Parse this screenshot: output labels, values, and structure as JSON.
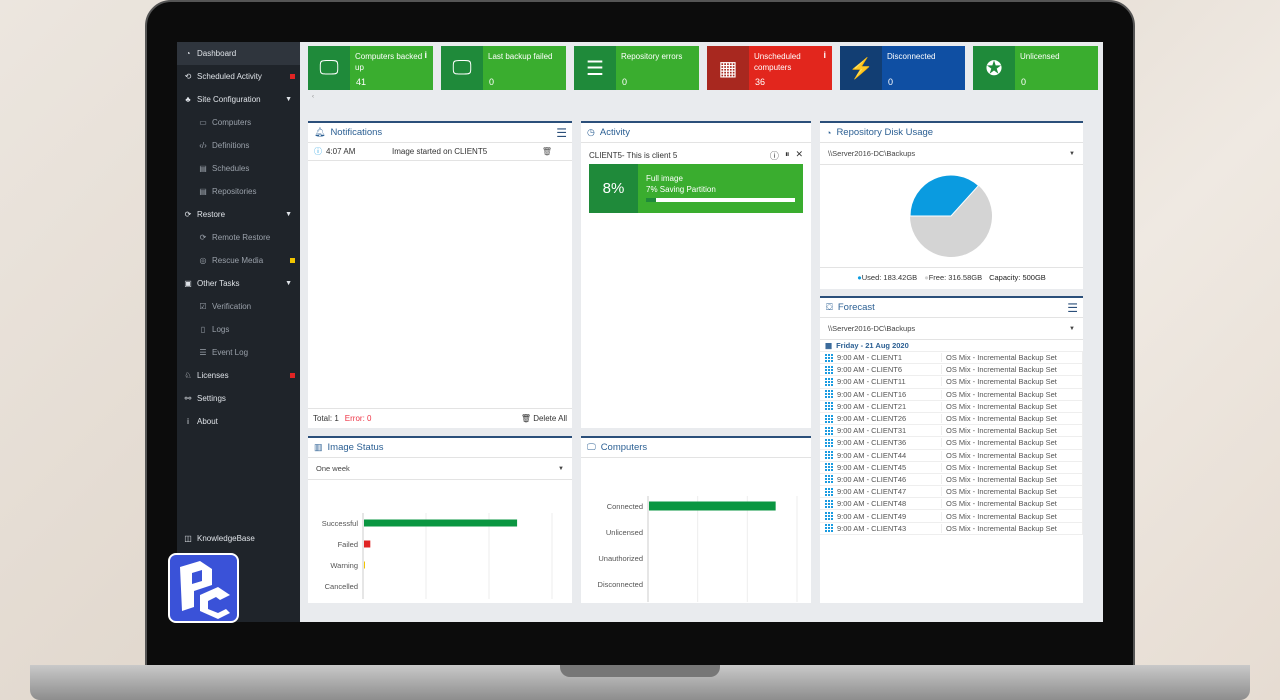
{
  "sidebar": {
    "items": [
      {
        "label": "Dashboard",
        "icon": "◔",
        "name": "dashboard",
        "active": true
      },
      {
        "label": "Scheduled Activity",
        "icon": "⟲",
        "name": "scheduled-activity",
        "flag": "#e02424"
      },
      {
        "label": "Site Configuration",
        "icon": "♣",
        "name": "site-configuration",
        "caret": true
      },
      {
        "label": "Computers",
        "icon": "▭",
        "name": "computers",
        "sub": true
      },
      {
        "label": "Definitions",
        "icon": "‹/›",
        "name": "definitions",
        "sub": true
      },
      {
        "label": "Schedules",
        "icon": "▤",
        "name": "schedules",
        "sub": true
      },
      {
        "label": "Repositories",
        "icon": "▤",
        "name": "repositories",
        "sub": true
      },
      {
        "label": "Restore",
        "icon": "⟳",
        "name": "restore",
        "caret": true
      },
      {
        "label": "Remote Restore",
        "icon": "⟳",
        "name": "remote-restore",
        "sub": true
      },
      {
        "label": "Rescue Media",
        "icon": "◎",
        "name": "rescue-media",
        "sub": true,
        "flag": "#f2c500"
      },
      {
        "label": "Other Tasks",
        "icon": "▣",
        "name": "other-tasks",
        "caret": true
      },
      {
        "label": "Verification",
        "icon": "☑",
        "name": "verification",
        "sub": true
      },
      {
        "label": "Logs",
        "icon": "▯",
        "name": "logs",
        "sub": true
      },
      {
        "label": "Event Log",
        "icon": "☰",
        "name": "event-log",
        "sub": true
      },
      {
        "label": "Licenses",
        "icon": "♘",
        "name": "licenses",
        "flag": "#e02424"
      },
      {
        "label": "Settings",
        "icon": "⚯",
        "name": "settings"
      },
      {
        "label": "About",
        "icon": "i",
        "name": "about"
      }
    ],
    "knowledgebase": "KnowledgeBase"
  },
  "tiles": [
    {
      "label": "Computers backed up",
      "value": "41",
      "icon": "monitor",
      "glyph": "🖵",
      "dark": "#1f8a3a",
      "light": "#3aad2f",
      "info": "i"
    },
    {
      "label": "Last backup failed",
      "value": "0",
      "icon": "monitor",
      "glyph": "🖵",
      "dark": "#1f8a3a",
      "light": "#3aad2f"
    },
    {
      "label": "Repository errors",
      "value": "0",
      "icon": "repository",
      "glyph": "☰",
      "dark": "#1f8a3a",
      "light": "#3aad2f"
    },
    {
      "label": "Unscheduled computers",
      "value": "36",
      "icon": "calendar",
      "glyph": "▦",
      "dark": "#a8281f",
      "light": "#e2261d",
      "info": "i"
    },
    {
      "label": "Disconnected",
      "value": "0",
      "icon": "plug",
      "glyph": "⚡",
      "dark": "#123e73",
      "light": "#0f4fa3"
    },
    {
      "label": "Unlicensed",
      "value": "0",
      "icon": "award",
      "glyph": "✪",
      "dark": "#1f8a3a",
      "light": "#3aad2f"
    }
  ],
  "notifications": {
    "title": "Notifications",
    "items": [
      {
        "time": "4:07 AM",
        "message": "Image started on CLIENT5"
      }
    ],
    "total": "Total: 1",
    "error": "Error: 0",
    "delete_all": "Delete All"
  },
  "activity": {
    "title": "Activity",
    "client": "CLIENT5- This is client 5",
    "percent": "8%",
    "task": "Full image",
    "step": "7% Saving Partition",
    "progress": 0.07
  },
  "disk": {
    "title": "Repository Disk Usage",
    "path": "\\\\Server2016-DC\\Backups",
    "used": "Used: 183.42GB",
    "free": "Free: 316.58GB",
    "capacity": "Capacity: 500GB",
    "used_gb": 183.42,
    "free_gb": 316.58,
    "used_color": "#0a9be0",
    "free_color": "#d4d4d4"
  },
  "forecast": {
    "title": "Forecast",
    "path": "\\\\Server2016-DC\\Backups",
    "date": "Friday - 21 Aug 2020",
    "rows": [
      {
        "time": "9:00 AM - CLIENT1",
        "set": "OS Mix - Incremental Backup Set"
      },
      {
        "time": "9:00 AM - CLIENT6",
        "set": "OS Mix - Incremental Backup Set"
      },
      {
        "time": "9:00 AM - CLIENT11",
        "set": "OS Mix - Incremental Backup Set"
      },
      {
        "time": "9:00 AM - CLIENT16",
        "set": "OS Mix - Incremental Backup Set"
      },
      {
        "time": "9:00 AM - CLIENT21",
        "set": "OS Mix - Incremental Backup Set"
      },
      {
        "time": "9:00 AM - CLIENT26",
        "set": "OS Mix - Incremental Backup Set"
      },
      {
        "time": "9:00 AM - CLIENT31",
        "set": "OS Mix - Incremental Backup Set"
      },
      {
        "time": "9:00 AM - CLIENT36",
        "set": "OS Mix - Incremental Backup Set"
      },
      {
        "time": "9:00 AM - CLIENT44",
        "set": "OS Mix - Incremental Backup Set"
      },
      {
        "time": "9:00 AM - CLIENT45",
        "set": "OS Mix - Incremental Backup Set"
      },
      {
        "time": "9:00 AM - CLIENT46",
        "set": "OS Mix - Incremental Backup Set"
      },
      {
        "time": "9:00 AM - CLIENT47",
        "set": "OS Mix - Incremental Backup Set"
      },
      {
        "time": "9:00 AM - CLIENT48",
        "set": "OS Mix - Incremental Backup Set"
      },
      {
        "time": "9:00 AM - CLIENT49",
        "set": "OS Mix - Incremental Backup Set"
      },
      {
        "time": "9:00 AM - CLIENT43",
        "set": "OS Mix - Incremental Backup Set"
      }
    ]
  },
  "image_status": {
    "title": "Image Status",
    "period": "One week"
  },
  "computers": {
    "title": "Computers"
  },
  "chart_data": [
    {
      "type": "bar",
      "orientation": "horizontal",
      "title": "Image Status",
      "categories": [
        "Successful",
        "Failed",
        "Warning",
        "Cancelled"
      ],
      "values": [
        2430,
        100,
        5,
        0
      ],
      "colors": [
        "#0a9641",
        "#e02424",
        "#f2c500",
        "#cccccc"
      ],
      "xlim": [
        0,
        3000
      ],
      "xticks": [
        0,
        1000,
        2000,
        3000
      ],
      "grid": true
    },
    {
      "type": "bar",
      "orientation": "horizontal",
      "title": "Computers",
      "categories": [
        "Connected",
        "Unlicensed",
        "Unauthorized",
        "Disconnected"
      ],
      "values": [
        51,
        0,
        0,
        0
      ],
      "colors": [
        "#0a9641",
        "#0a9641",
        "#0a9641",
        "#0a9641"
      ],
      "xlim": [
        0,
        60
      ],
      "xticks": [
        0,
        20,
        40,
        60
      ],
      "grid": true
    }
  ]
}
